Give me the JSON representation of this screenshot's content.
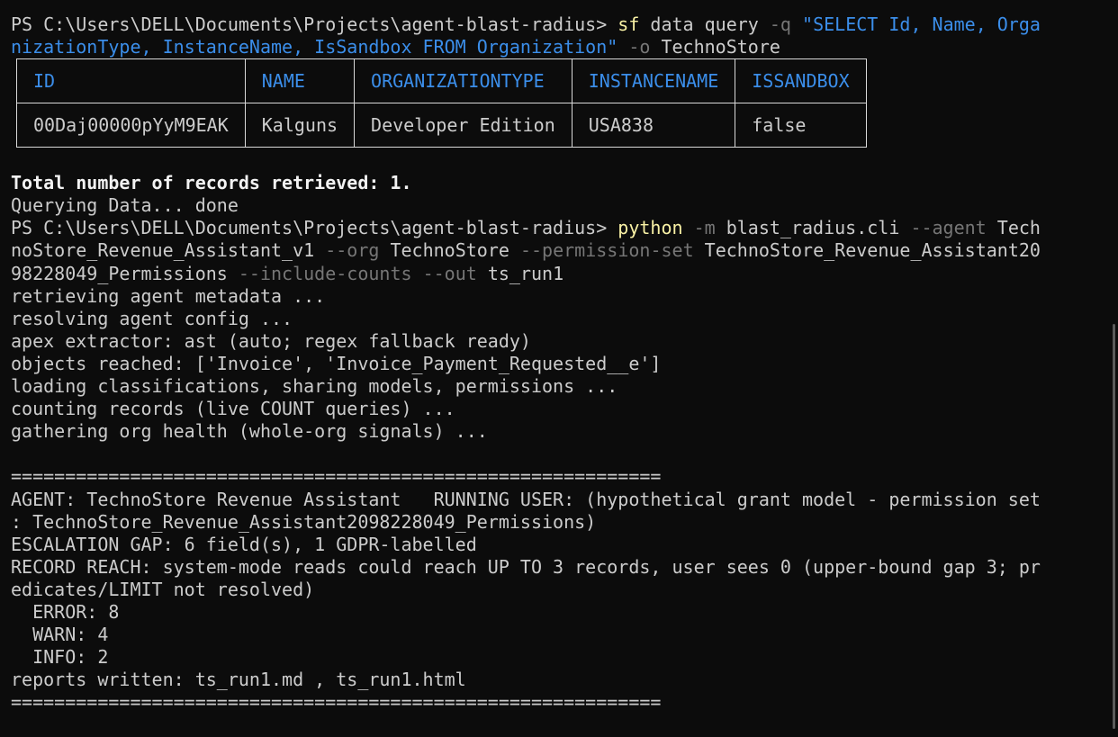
{
  "cmd1": {
    "prompt": "PS C:\\Users\\DELL\\Documents\\Projects\\agent-blast-radius> ",
    "exe": "sf",
    "p1": " data query ",
    "flag_q": "-q",
    "sp1": " ",
    "soql_a": "\"SELECT Id, Name, Orga",
    "soql_b": "nizationType, InstanceName, IsSandbox FROM Organization\"",
    "sp2": " ",
    "flag_o": "-o",
    "org": " TechnoStore"
  },
  "table": {
    "headers": [
      "ID",
      "NAME",
      "ORGANIZATIONTYPE",
      "INSTANCENAME",
      "ISSANDBOX"
    ],
    "rows": [
      [
        "00Daj00000pYyM9EAK",
        "Kalguns",
        "Developer Edition",
        "USA838",
        "false"
      ]
    ]
  },
  "total_line": "Total number of records retrieved: 1.",
  "querying_line": "Querying Data... done",
  "cmd2": {
    "prompt": "PS C:\\Users\\DELL\\Documents\\Projects\\agent-blast-radius> ",
    "exe": "python",
    "sp0": " ",
    "flag_m": "-m",
    "module": " blast_radius.cli ",
    "flag_agent": "--agent",
    "agent_a": " Tech",
    "agent_b": "noStore_Revenue_Assistant_v1 ",
    "flag_org": "--org",
    "org": " TechnoStore ",
    "flag_ps": "--permission-set",
    "ps_a": " TechnoStore_Revenue_Assistant20",
    "ps_b": "98228049_Permissions ",
    "flag_counts": "--include-counts",
    "sp1": " ",
    "flag_out": "--out",
    "out": " ts_run1"
  },
  "progress": [
    "retrieving agent metadata ...",
    "resolving agent config ...",
    "apex extractor: ast (auto; regex fallback ready)",
    "objects reached: ['Invoice', 'Invoice_Payment_Requested__e']",
    "loading classifications, sharing models, permissions ...",
    "counting records (live COUNT queries) ...",
    "gathering org health (whole-org signals) ..."
  ],
  "separator": "============================================================",
  "report": [
    "AGENT: TechnoStore Revenue Assistant   RUNNING USER: (hypothetical grant model - permission set",
    ": TechnoStore_Revenue_Assistant2098228049_Permissions)",
    "ESCALATION GAP: 6 field(s), 1 GDPR-labelled",
    "RECORD REACH: system-mode reads could reach UP TO 3 records, user sees 0 (upper-bound gap 3; pr",
    "edicates/LIMIT not resolved)",
    "  ERROR: 8",
    "  WARN: 4",
    "  INFO: 2",
    "reports written: ts_run1.md , ts_run1.html"
  ],
  "colors": {
    "background": "#0c0c0c",
    "text": "#cccccc",
    "command": "#f9f1a5",
    "flag": "#767676",
    "string": "#3b8eea",
    "table_header": "#3b8eea"
  }
}
